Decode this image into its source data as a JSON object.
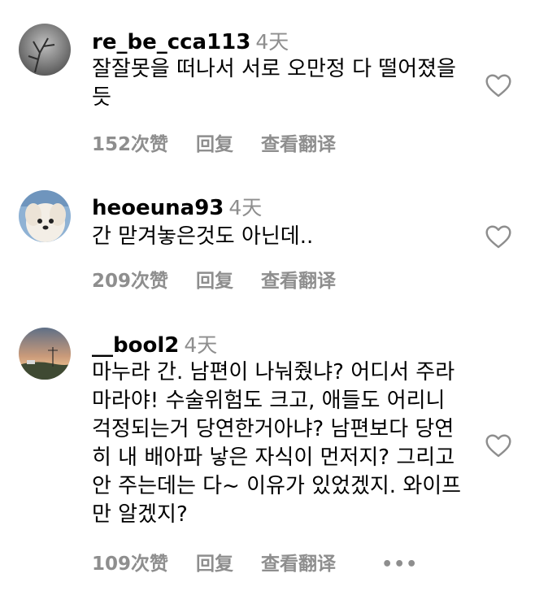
{
  "comments": [
    {
      "username": "re_be_cca113",
      "time": "4天",
      "text": "잘잘못을 떠나서 서로 오만정 다 떨어졌을듯",
      "likes": "152次赞",
      "reply": "回复",
      "translate": "查看翻译"
    },
    {
      "username": "heoeuna93",
      "time": "4天",
      "text": "간 맏겨놓은것도 아닌데..",
      "likes": "209次赞",
      "reply": "回复",
      "translate": "查看翻译"
    },
    {
      "username": "__bool2",
      "time": "4天",
      "text": "마누라 간. 남편이 나눠줬냐? 어디서 주라마라야! 수술위험도 크고, 애들도 어리니 걱정되는거 당연한거아냐? 남편보다 당연히 내 배아파 낳은 자식이 먼저지? 그리고 안 주는데는 다~ 이유가 있었겠지. 와이프만 알겠지?",
      "likes": "109次赞",
      "reply": "回复",
      "translate": "查看翻译",
      "more": "•••"
    }
  ]
}
